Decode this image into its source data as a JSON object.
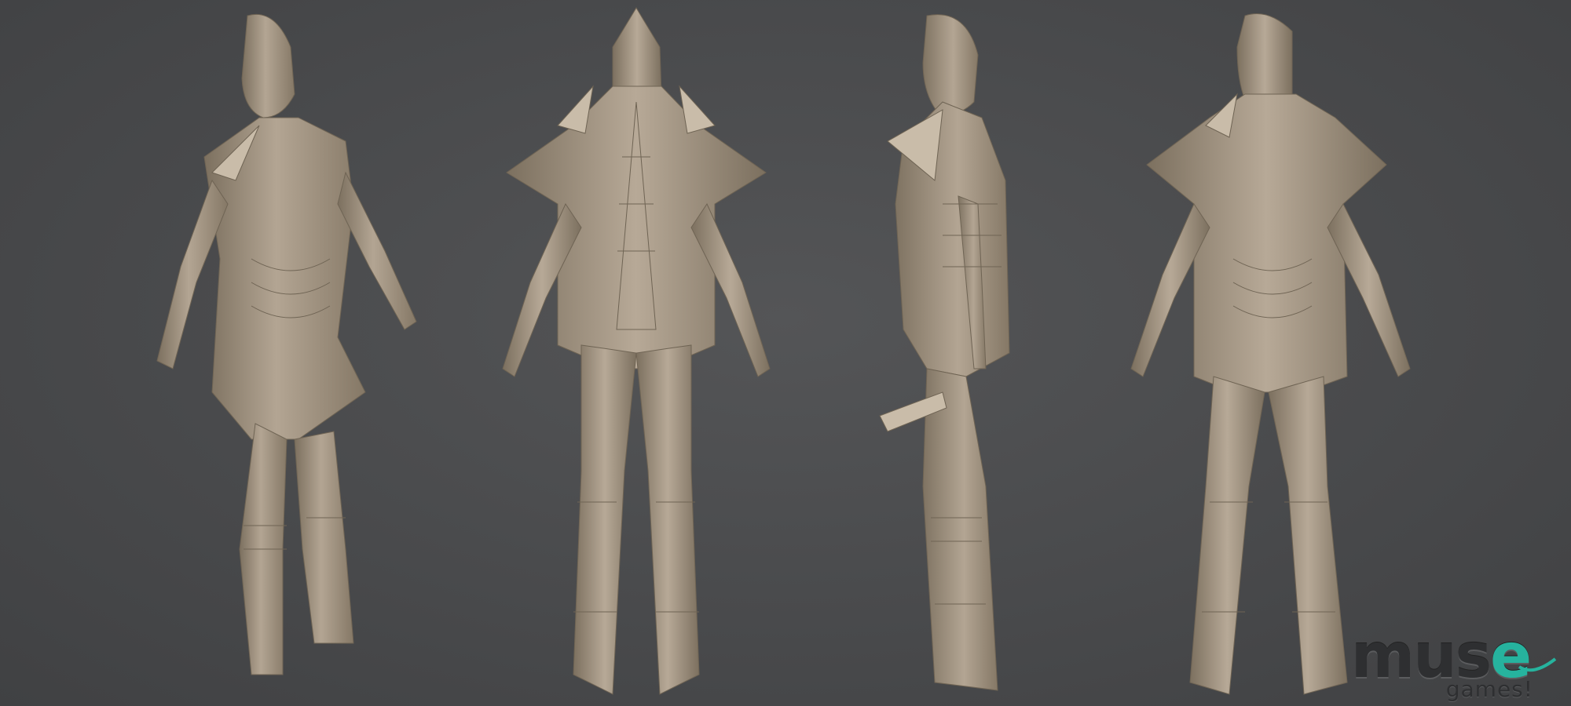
{
  "scene": {
    "background": "#4a4b4d",
    "sculpt_color": "#a89a88",
    "sculpt_shade": "#7c705f",
    "sculpt_light": "#c9bca9",
    "views": [
      {
        "label": "three-quarter-front"
      },
      {
        "label": "back"
      },
      {
        "label": "side"
      },
      {
        "label": "front"
      }
    ]
  },
  "logo": {
    "word_main": "mus",
    "word_accent": "e",
    "sub": "games!",
    "accent_color": "#26b39e"
  }
}
